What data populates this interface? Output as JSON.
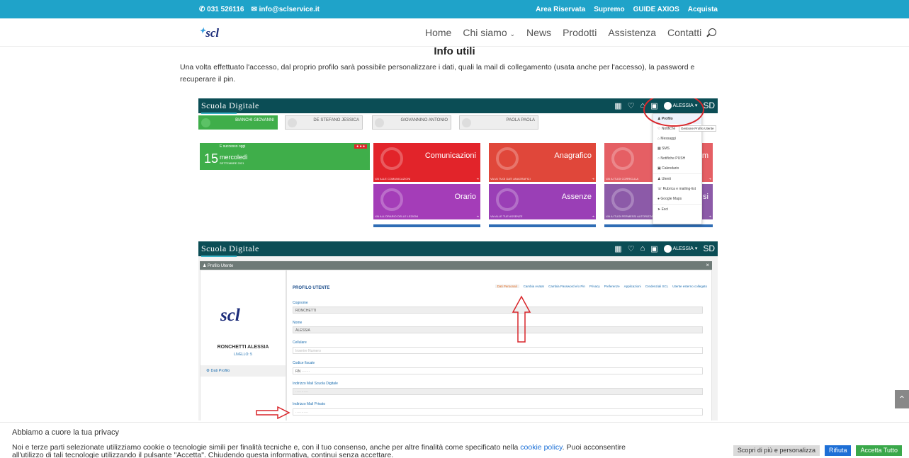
{
  "topbar": {
    "phone": "031 526116",
    "email": "info@sclservice.it",
    "links": [
      "Area Riservata",
      "Supremo",
      "GUIDE AXIOS",
      "Acquista"
    ]
  },
  "header": {
    "logo": "scl",
    "nav": [
      "Home",
      "Chi siamo",
      "News",
      "Prodotti",
      "Assistenza",
      "Contatti"
    ]
  },
  "main": {
    "title": "Info utili",
    "intro": "Una volta effettuato l'accesso, dal proprio profilo sarà possibile personalizzare i dati, quali la mail di collegamento (usata anche per l'accesso), la password e recuperare il pin."
  },
  "shot1": {
    "brand": "Scuola Digitale",
    "user": "ALESSIA",
    "people": [
      "BIANCHI GIOVANNI",
      "DE STEFANO JESSICA",
      "GIOVANNINO ANTONIO",
      "PAOLA PAOLA"
    ],
    "date": {
      "caption": "E successo oggi",
      "day": "15",
      "weekday": "mercoledì",
      "month": "SETTEMBRE 2021"
    },
    "tiles": [
      {
        "title": "Comunicazioni",
        "foot": "VAI ALLE COMUNICAZIONI",
        "color": "#e2242a"
      },
      {
        "title": "Anagrafico",
        "foot": "VAI AI TUOI DATI ANAGRAFICI",
        "color": "#e0473a"
      },
      {
        "title": "m",
        "foot": "VAI AI TUOI CORRICULA",
        "color": "#e55f64"
      },
      {
        "title": "Orario",
        "foot": "VAI ALL'ORARIO DELLE LEZIONI",
        "color": "#a43db8"
      },
      {
        "title": "Assenze",
        "foot": "VAI ALLE TUE ASSENZE",
        "color": "#9a3fb6"
      },
      {
        "title": "si",
        "foot": "VAI AI TUOI PERMESSI AUTORIZZATI",
        "color": "#8c5aa8"
      }
    ],
    "menu": [
      "Profilo",
      "Notifiche",
      "Messaggi",
      "SMS",
      "Notifiche PUSH",
      "Calendario",
      "Utenti",
      "Rubrica e mailing-list",
      "Google Maps",
      "Esci"
    ],
    "menu_tooltip": "Gestione Profilo Utente"
  },
  "shot2": {
    "brand": "Scuola Digitale",
    "user": "ALESSIA",
    "panel_title": "Profilo Utente",
    "logo": "scl",
    "name": "RONCHETTI ALESSIA",
    "level": "LIVELLO: 5",
    "side_item": "Dati Profilo",
    "heading": "PROFILO UTENTE",
    "tabs": [
      "Dati Personali",
      "Cambia Avatar",
      "Cambia Password e/o Pin",
      "Privacy",
      "Preferenze",
      "Applicazioni",
      "Credenziali SCL",
      "Utente esterno collegato"
    ],
    "fields": [
      {
        "label": "Cognome",
        "value": "RONCHETTI"
      },
      {
        "label": "Nome",
        "value": "ALESSIA"
      },
      {
        "label": "Cellulare",
        "value": "Inserire Numero"
      },
      {
        "label": "Codice fiscale",
        "value": "RN"
      },
      {
        "label": "Indirizzo Mail Scuola Digitale",
        "value": ""
      },
      {
        "label": "Indirizzo Mail Privato",
        "value": ""
      }
    ]
  },
  "privacy": {
    "title": "Abbiamo a cuore la tua privacy",
    "text_before": "Noi e terze parti selezionate utilizziamo cookie o tecnologie simili per finalità tecniche e, con il tuo consenso, anche per altre finalità come specificato nella ",
    "link": "cookie policy",
    "text_after": ". Puoi acconsentire all'utilizzo di tali tecnologie utilizzando il pulsante \"Accetta\". Chiudendo questa informativa, continui senza accettare.",
    "btn_more": "Scopri di più e personalizza",
    "btn_reject": "Rifiuta",
    "btn_accept": "Accetta Tutto"
  }
}
